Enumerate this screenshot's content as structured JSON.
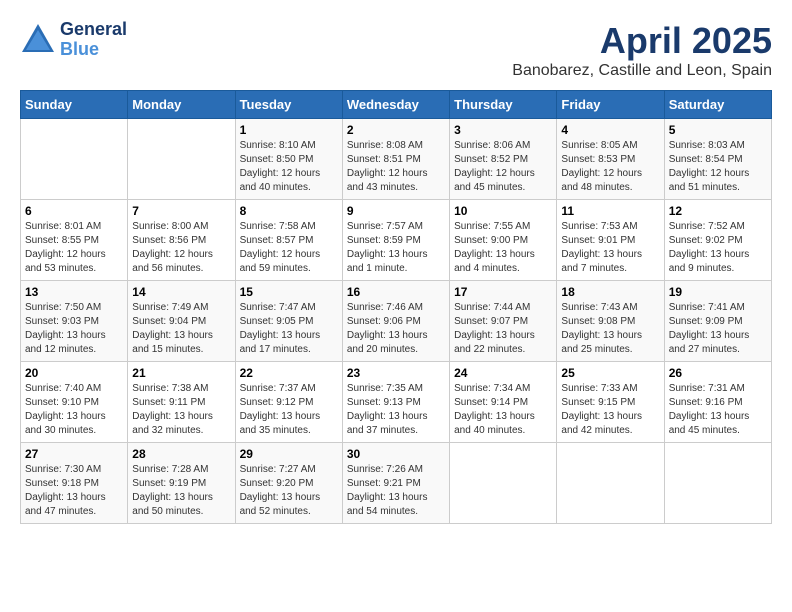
{
  "header": {
    "logo_line1": "General",
    "logo_line2": "Blue",
    "title": "April 2025",
    "subtitle": "Banobarez, Castille and Leon, Spain"
  },
  "weekdays": [
    "Sunday",
    "Monday",
    "Tuesday",
    "Wednesday",
    "Thursday",
    "Friday",
    "Saturday"
  ],
  "weeks": [
    [
      {
        "day": "",
        "info": ""
      },
      {
        "day": "",
        "info": ""
      },
      {
        "day": "1",
        "info": "Sunrise: 8:10 AM\nSunset: 8:50 PM\nDaylight: 12 hours and 40 minutes."
      },
      {
        "day": "2",
        "info": "Sunrise: 8:08 AM\nSunset: 8:51 PM\nDaylight: 12 hours and 43 minutes."
      },
      {
        "day": "3",
        "info": "Sunrise: 8:06 AM\nSunset: 8:52 PM\nDaylight: 12 hours and 45 minutes."
      },
      {
        "day": "4",
        "info": "Sunrise: 8:05 AM\nSunset: 8:53 PM\nDaylight: 12 hours and 48 minutes."
      },
      {
        "day": "5",
        "info": "Sunrise: 8:03 AM\nSunset: 8:54 PM\nDaylight: 12 hours and 51 minutes."
      }
    ],
    [
      {
        "day": "6",
        "info": "Sunrise: 8:01 AM\nSunset: 8:55 PM\nDaylight: 12 hours and 53 minutes."
      },
      {
        "day": "7",
        "info": "Sunrise: 8:00 AM\nSunset: 8:56 PM\nDaylight: 12 hours and 56 minutes."
      },
      {
        "day": "8",
        "info": "Sunrise: 7:58 AM\nSunset: 8:57 PM\nDaylight: 12 hours and 59 minutes."
      },
      {
        "day": "9",
        "info": "Sunrise: 7:57 AM\nSunset: 8:59 PM\nDaylight: 13 hours and 1 minute."
      },
      {
        "day": "10",
        "info": "Sunrise: 7:55 AM\nSunset: 9:00 PM\nDaylight: 13 hours and 4 minutes."
      },
      {
        "day": "11",
        "info": "Sunrise: 7:53 AM\nSunset: 9:01 PM\nDaylight: 13 hours and 7 minutes."
      },
      {
        "day": "12",
        "info": "Sunrise: 7:52 AM\nSunset: 9:02 PM\nDaylight: 13 hours and 9 minutes."
      }
    ],
    [
      {
        "day": "13",
        "info": "Sunrise: 7:50 AM\nSunset: 9:03 PM\nDaylight: 13 hours and 12 minutes."
      },
      {
        "day": "14",
        "info": "Sunrise: 7:49 AM\nSunset: 9:04 PM\nDaylight: 13 hours and 15 minutes."
      },
      {
        "day": "15",
        "info": "Sunrise: 7:47 AM\nSunset: 9:05 PM\nDaylight: 13 hours and 17 minutes."
      },
      {
        "day": "16",
        "info": "Sunrise: 7:46 AM\nSunset: 9:06 PM\nDaylight: 13 hours and 20 minutes."
      },
      {
        "day": "17",
        "info": "Sunrise: 7:44 AM\nSunset: 9:07 PM\nDaylight: 13 hours and 22 minutes."
      },
      {
        "day": "18",
        "info": "Sunrise: 7:43 AM\nSunset: 9:08 PM\nDaylight: 13 hours and 25 minutes."
      },
      {
        "day": "19",
        "info": "Sunrise: 7:41 AM\nSunset: 9:09 PM\nDaylight: 13 hours and 27 minutes."
      }
    ],
    [
      {
        "day": "20",
        "info": "Sunrise: 7:40 AM\nSunset: 9:10 PM\nDaylight: 13 hours and 30 minutes."
      },
      {
        "day": "21",
        "info": "Sunrise: 7:38 AM\nSunset: 9:11 PM\nDaylight: 13 hours and 32 minutes."
      },
      {
        "day": "22",
        "info": "Sunrise: 7:37 AM\nSunset: 9:12 PM\nDaylight: 13 hours and 35 minutes."
      },
      {
        "day": "23",
        "info": "Sunrise: 7:35 AM\nSunset: 9:13 PM\nDaylight: 13 hours and 37 minutes."
      },
      {
        "day": "24",
        "info": "Sunrise: 7:34 AM\nSunset: 9:14 PM\nDaylight: 13 hours and 40 minutes."
      },
      {
        "day": "25",
        "info": "Sunrise: 7:33 AM\nSunset: 9:15 PM\nDaylight: 13 hours and 42 minutes."
      },
      {
        "day": "26",
        "info": "Sunrise: 7:31 AM\nSunset: 9:16 PM\nDaylight: 13 hours and 45 minutes."
      }
    ],
    [
      {
        "day": "27",
        "info": "Sunrise: 7:30 AM\nSunset: 9:18 PM\nDaylight: 13 hours and 47 minutes."
      },
      {
        "day": "28",
        "info": "Sunrise: 7:28 AM\nSunset: 9:19 PM\nDaylight: 13 hours and 50 minutes."
      },
      {
        "day": "29",
        "info": "Sunrise: 7:27 AM\nSunset: 9:20 PM\nDaylight: 13 hours and 52 minutes."
      },
      {
        "day": "30",
        "info": "Sunrise: 7:26 AM\nSunset: 9:21 PM\nDaylight: 13 hours and 54 minutes."
      },
      {
        "day": "",
        "info": ""
      },
      {
        "day": "",
        "info": ""
      },
      {
        "day": "",
        "info": ""
      }
    ]
  ]
}
